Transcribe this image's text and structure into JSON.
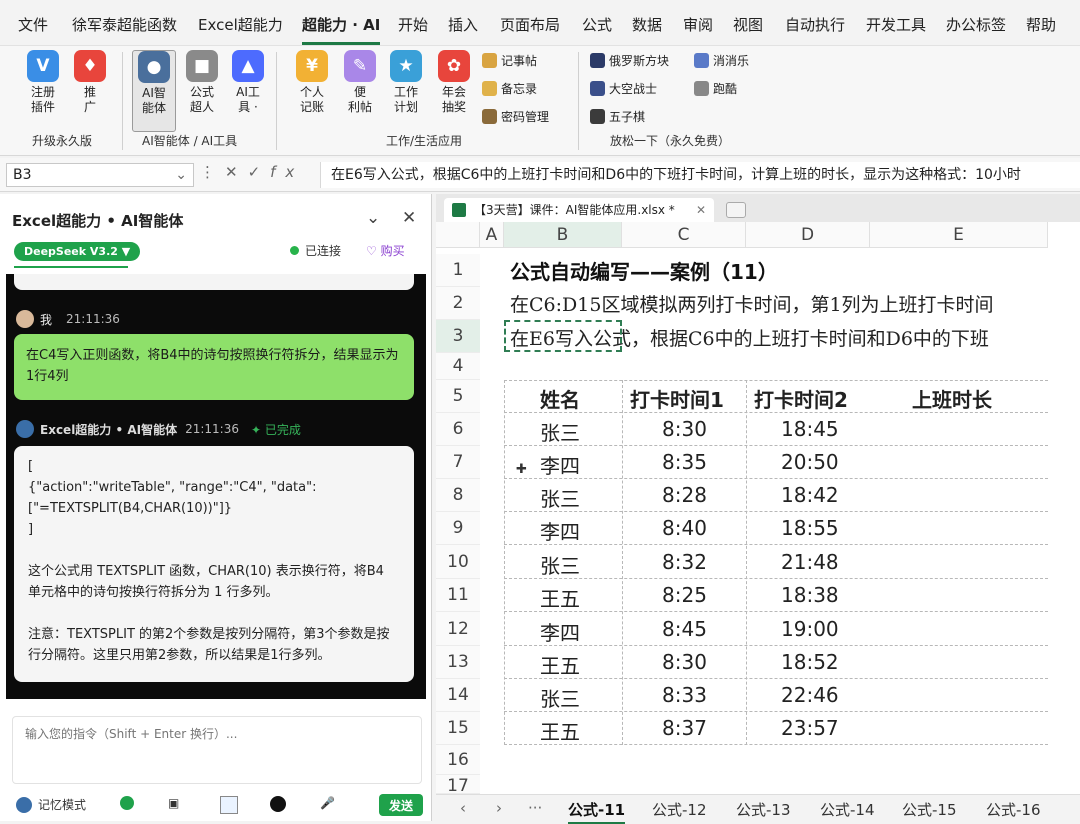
{
  "menu": [
    "文件",
    "徐军泰超能函数",
    "Excel超能力",
    "超能力 · AI",
    "开始",
    "插入",
    "页面布局",
    "公式",
    "数据",
    "审阅",
    "视图",
    "自动执行",
    "开发工具",
    "办公标签",
    "帮助"
  ],
  "ribbon": {
    "buttons": [
      {
        "label": "注册\n插件",
        "icon": "vip-icon",
        "color": "#3a8ee6"
      },
      {
        "label": "推\n广",
        "icon": "gift-icon",
        "color": "#e8453c"
      },
      {
        "label": "AI智\n能体",
        "icon": "ai-avatar-icon",
        "color": "#4a6f9c"
      },
      {
        "label": "公式\n超人",
        "icon": "robot-icon",
        "color": "#8a8a8a"
      },
      {
        "label": "AI工\n具 ·",
        "icon": "deepseek-whale-icon",
        "color": "#4d6bfe"
      },
      {
        "label": "个人\n记账",
        "icon": "piggy-bank-icon",
        "color": "#f2b134"
      },
      {
        "label": "便\n利帖",
        "icon": "sticky-note-icon",
        "color": "#a987e8"
      },
      {
        "label": "工作\n计划",
        "icon": "plan-icon",
        "color": "#3aa0d8"
      },
      {
        "label": "年会\n抽奖",
        "icon": "lottery-icon",
        "color": "#e8453c"
      }
    ],
    "small_col1": [
      "记事帖",
      "备忘录",
      "密码管理"
    ],
    "small_col2": [
      "俄罗斯方块",
      "大空战士",
      "五子棋"
    ],
    "small_col3": [
      "消消乐",
      "跑酷"
    ],
    "groups": [
      "升级永久版",
      "AI智能体 / AI工具",
      "工作/生活应用",
      "放松一下（永久免费）"
    ]
  },
  "formula_bar": {
    "name_box": "B3",
    "formula": "在E6写入公式，根据C6中的上班打卡时间和D6中的下班打卡时间，计算上班的时长，显示为这种格式：10小时"
  },
  "pane": {
    "title": "Excel超能力 • AI智能体",
    "model": "DeepSeek V3.2 ▼",
    "status": "已连接",
    "buy": "购买",
    "user_name": "我",
    "user_time": "21:11:36",
    "user_message": "在C4写入正则函数，将B4中的诗句按照换行符拆分，结果显示为1行4列",
    "bot_name": "Excel超能力 • AI智能体",
    "bot_time": "21:11:36",
    "bot_status": "已完成",
    "bot_lines": [
      "[",
      "{\"action\":\"writeTable\", \"range\":\"C4\", \"data\":",
      "[\"=TEXTSPLIT(B4,CHAR(10))\"]}",
      "]",
      "",
      "这个公式用 TEXTSPLIT 函数，CHAR(10) 表示换行符，将B4 单元格中的诗句按换行符拆分为 1 行多列。",
      "",
      "注意：TEXTSPLIT 的第2个参数是按列分隔符，第3个参数是按行分隔符。这里只用第2参数，所以结果是1行多列。"
    ],
    "input_placeholder": "输入您的指令（Shift + Enter 换行）...",
    "memory_mode": "记忆模式",
    "send": "发送"
  },
  "sheet": {
    "file_tab": "【3天营】课件：AI智能体应用.xlsx *",
    "columns": [
      "A",
      "B",
      "C",
      "D",
      "E"
    ],
    "rows": [
      "1",
      "2",
      "3",
      "4",
      "5",
      "6",
      "7",
      "8",
      "9",
      "10",
      "11",
      "12",
      "13",
      "14",
      "15",
      "16",
      "17"
    ],
    "title": "公式自动编写——案例（11）",
    "line2": "在C6:D15区域模拟两列打卡时间，第1列为上班打卡时间",
    "line3": "在E6写入公式，根据C6中的上班打卡时间和D6中的下班",
    "headers": [
      "姓名",
      "打卡时间1",
      "打卡时间2",
      "上班时长"
    ],
    "data": [
      [
        "张三",
        "8:30",
        "18:45"
      ],
      [
        "李四",
        "8:35",
        "20:50"
      ],
      [
        "张三",
        "8:28",
        "18:42"
      ],
      [
        "李四",
        "8:40",
        "18:55"
      ],
      [
        "张三",
        "8:32",
        "21:48"
      ],
      [
        "王五",
        "8:25",
        "18:38"
      ],
      [
        "李四",
        "8:45",
        "19:00"
      ],
      [
        "王五",
        "8:30",
        "18:52"
      ],
      [
        "张三",
        "8:33",
        "22:46"
      ],
      [
        "王五",
        "8:37",
        "23:57"
      ]
    ],
    "sheet_tabs": [
      "公式-11",
      "公式-12",
      "公式-13",
      "公式-14",
      "公式-15",
      "公式-16"
    ]
  }
}
